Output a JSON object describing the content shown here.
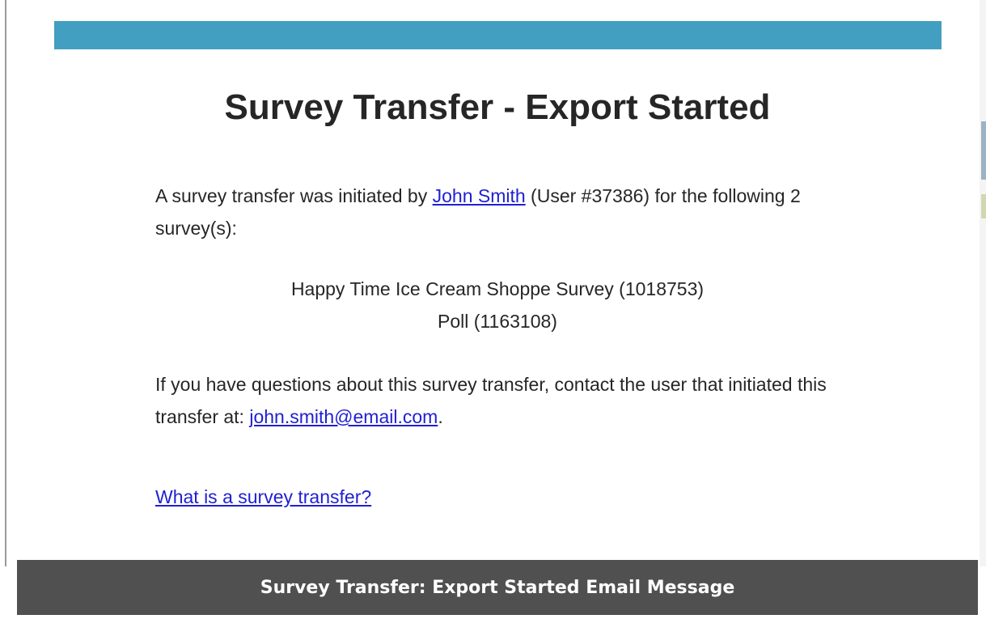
{
  "email": {
    "title": "Survey Transfer - Export Started",
    "intro_before": "A survey transfer was initiated by ",
    "user_link": "John Smith",
    "intro_after": " (User #37386) for the following 2 survey(s):",
    "surveys": [
      "Happy Time Ice Cream Shoppe Survey (1018753)",
      "Poll (1163108)"
    ],
    "questions_text": "If you have questions about this survey transfer, contact the user that initiated this transfer at: ",
    "email_link": "john.smith@email.com",
    "questions_end": ".",
    "help_link": "What is a survey transfer?"
  },
  "caption": {
    "text": "Survey Transfer: Export Started Email Message"
  },
  "colors": {
    "header_bar": "#439fc1",
    "caption_bar": "#505050",
    "link": "#1f1fd4",
    "text": "#262626"
  }
}
